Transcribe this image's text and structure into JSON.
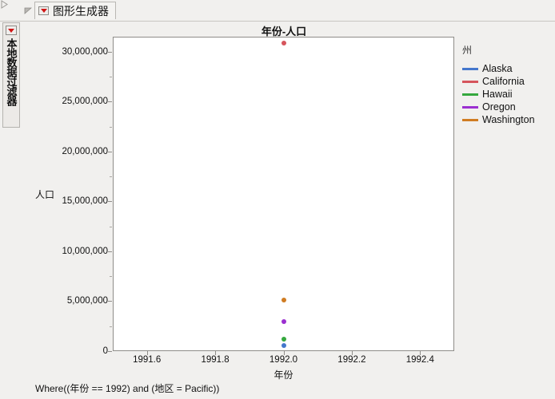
{
  "window": {
    "title": "图形生成器",
    "outer_disclosure_icon": "triangle-right-icon",
    "inner_disclosure_icon": "triangle-down-icon",
    "title_icon": "red-triangle-icon"
  },
  "filter_panel": {
    "label": "本地数据过滤器",
    "icon": "red-triangle-icon"
  },
  "chart": {
    "title": "年份-人口",
    "where_clause": "Where((年份 == 1992) and (地区 = Pacific))"
  },
  "legend": {
    "title": "州"
  },
  "chart_data": {
    "type": "scatter",
    "title": "年份-人口",
    "xlabel": "年份",
    "ylabel": "人口",
    "xlim": [
      1991.5,
      1992.5
    ],
    "ylim": [
      0,
      31500000
    ],
    "xticks": [
      1991.6,
      1991.8,
      1992.0,
      1992.2,
      1992.4
    ],
    "xtick_labels": [
      "1991.6",
      "1991.8",
      "1992.0",
      "1992.2",
      "1992.4"
    ],
    "yticks": [
      0,
      5000000,
      10000000,
      15000000,
      20000000,
      25000000,
      30000000
    ],
    "ytick_labels": [
      "0",
      "5,000,000",
      "10,000,000",
      "15,000,000",
      "20,000,000",
      "25,000,000",
      "30,000,000"
    ],
    "grid": false,
    "legend_position": "right",
    "legend_title": "州",
    "series": [
      {
        "name": "Alaska",
        "color": "#4477cc",
        "x": [
          1992.0
        ],
        "values": [
          570000
        ]
      },
      {
        "name": "California",
        "color": "#d6555c",
        "x": [
          1992.0
        ],
        "values": [
          30900000
        ]
      },
      {
        "name": "Hawaii",
        "color": "#35a83e",
        "x": [
          1992.0
        ],
        "values": [
          1160000
        ]
      },
      {
        "name": "Oregon",
        "color": "#9b2fd0",
        "x": [
          1992.0
        ],
        "values": [
          2970000
        ]
      },
      {
        "name": "Washington",
        "color": "#d07c22",
        "x": [
          1992.0
        ],
        "values": [
          5140000
        ]
      }
    ]
  }
}
